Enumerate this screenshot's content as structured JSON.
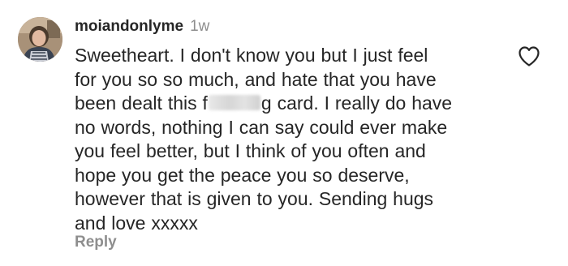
{
  "comment": {
    "username": "moiandonlyme",
    "time": "1w",
    "text_before_redaction": "Sweetheart. I don't know you but I just feel\nfor you so so much, and hate that you have\nbeen dealt this f",
    "text_after_redaction": "g card. I really do have\nno words, nothing I can say could ever make\nyou feel better, but I think of you often and\nhope you get the peace you so deserve,\nhowever that is given to you. Sending hugs\nand love xxxxx",
    "reply_label": "Reply"
  },
  "icons": {
    "like": "heart-outline-icon",
    "avatar": "profile-photo"
  },
  "colors": {
    "text": "#262626",
    "muted": "#8e8e8e",
    "background": "#ffffff"
  }
}
